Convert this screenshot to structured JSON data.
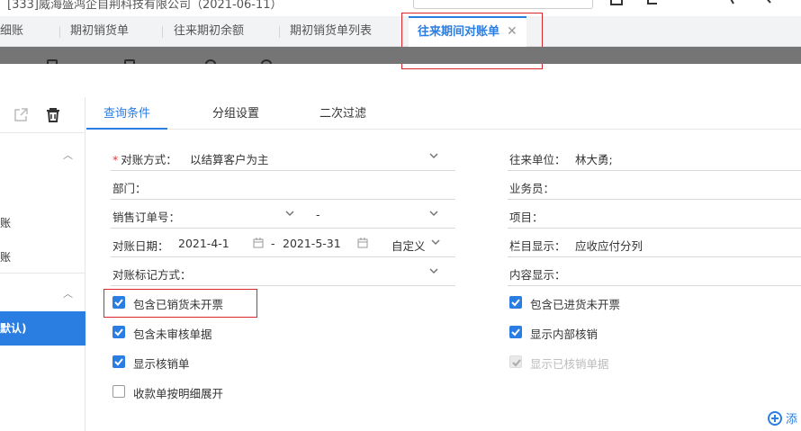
{
  "header": {
    "company": "[333]威海盛鸿企自荆科技有限公司（2021-06-11）"
  },
  "tabs": [
    {
      "label": "细账"
    },
    {
      "label": "期初销货单"
    },
    {
      "label": "往来期初余额"
    },
    {
      "label": "期初销货单列表"
    },
    {
      "label": "往来期间对账单",
      "active": true,
      "close": "✕"
    }
  ],
  "sidebar": {
    "items": [
      "账",
      "账"
    ],
    "selected": "默认)"
  },
  "subtabs": [
    "查询条件",
    "分组设置",
    "二次过滤"
  ],
  "form": {
    "method_label": "对账方式：",
    "method_required": "*",
    "method_value": "以结算客户为主",
    "dept_label": "部门：",
    "order_label": "销售订单号：",
    "order_sep": "-",
    "date_label": "对账日期：",
    "date_from": "2021-4-1",
    "date_sep": "-",
    "date_to": "2021-5-31",
    "date_mode": "自定义",
    "mark_label": "对账标记方式：",
    "partner_label": "往来单位：",
    "partner_value": "林大勇;",
    "salesman_label": "业务员：",
    "project_label": "项目：",
    "column_label": "栏目显示：",
    "column_value": "应收应付分列",
    "content_label": "内容显示："
  },
  "checks": {
    "c1": {
      "label": "包含已销货未开票",
      "checked": true
    },
    "c2": {
      "label": "包含未审核单据",
      "checked": true
    },
    "c3": {
      "label": "显示核销单",
      "checked": true
    },
    "c4": {
      "label": "收款单按明细展开",
      "checked": false
    },
    "c5": {
      "label": "包含已进货未开票",
      "checked": true
    },
    "c6": {
      "label": "显示内部核销",
      "checked": true
    },
    "c7": {
      "label": "显示已核销单据",
      "checked": true,
      "disabled": true
    }
  },
  "add_label": "添",
  "colors": {
    "accent": "#2a7de1",
    "highlight": "#d9262c",
    "toolbar": "#757575"
  }
}
